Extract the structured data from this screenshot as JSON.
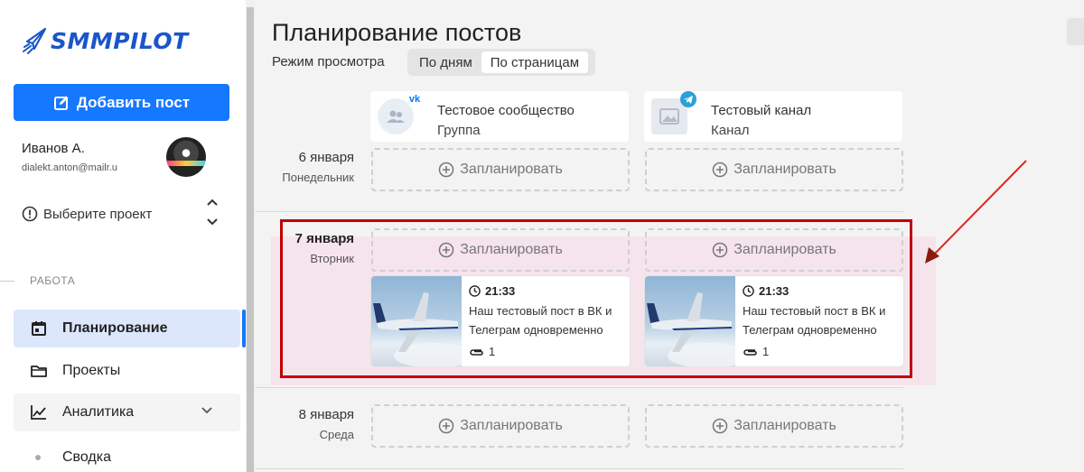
{
  "brand": {
    "name": "SMMPILOT",
    "color": "#1a56c9"
  },
  "sidebar": {
    "add_post": "Добавить пост",
    "user": {
      "name": "Иванов А.",
      "email": "dialekt.anton@mailr.u"
    },
    "project_select": "Выберите проект",
    "section_label": "РАБОТА",
    "nav": [
      {
        "label": "Планирование",
        "icon": "calendar-icon",
        "active": true
      },
      {
        "label": "Проекты",
        "icon": "folder-icon"
      },
      {
        "label": "Аналитика",
        "icon": "chart-line-icon",
        "expandable": true
      }
    ],
    "subnav": [
      {
        "label": "Сводка"
      }
    ]
  },
  "main": {
    "title": "Планирование постов",
    "view_mode_label": "Режим просмотра",
    "view_modes": [
      {
        "label": "По дням"
      },
      {
        "label": "По страницам",
        "selected": true
      }
    ],
    "channels": [
      {
        "name": "Тестовое сообщество",
        "type": "Группа",
        "network_icon": "vk-icon"
      },
      {
        "name": "Тестовый канал",
        "type": "Канал",
        "network_icon": "telegram-icon"
      }
    ],
    "days": [
      {
        "date": "6 января",
        "weekday": "Понедельник"
      },
      {
        "date": "7 января",
        "weekday": "Вторник",
        "highlighted": true
      },
      {
        "date": "8 января",
        "weekday": "Среда"
      }
    ],
    "schedule_label": "Запланировать",
    "posts": [
      {
        "time": "21:33",
        "text": "Наш тестовый пост в ВК и Телеграм одновременно",
        "attachments": "1"
      },
      {
        "time": "21:33",
        "text": "Наш тестовый пост в ВК и Телеграм одновременно",
        "attachments": "1"
      }
    ]
  },
  "colors": {
    "primary": "#1677ff",
    "highlight_border": "#c00000",
    "arrow": "#e0261f"
  }
}
